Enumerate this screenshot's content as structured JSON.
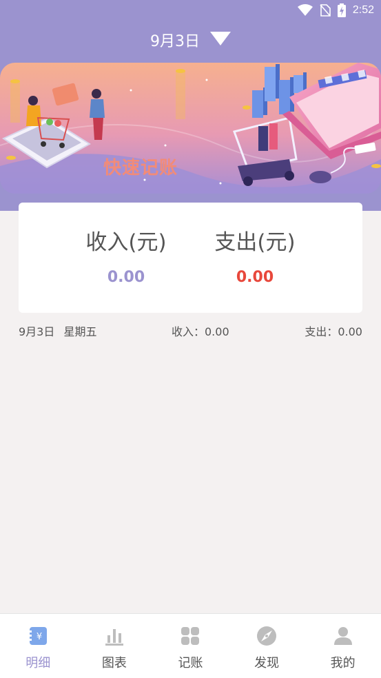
{
  "status_bar": {
    "time": "2:52",
    "icons": [
      "wifi-icon",
      "no-sim-icon",
      "battery-charging-icon"
    ]
  },
  "header": {
    "date": "9月3日",
    "dropdown_icon": "triangle-down-icon"
  },
  "banner": {
    "text": "快速记账"
  },
  "summary": {
    "income_label": "收入(元)",
    "income_value": "0.00",
    "expense_label": "支出(元)",
    "expense_value": "0.00"
  },
  "day": {
    "date": "9月3日",
    "weekday": "星期五",
    "income": "收入：0.00",
    "expense": "支出：0.00"
  },
  "tabs": [
    {
      "label": "明细",
      "icon": "ledger-icon",
      "active": true
    },
    {
      "label": "图表",
      "icon": "bar-chart-icon",
      "active": false
    },
    {
      "label": "记账",
      "icon": "grid-icon",
      "active": false
    },
    {
      "label": "发现",
      "icon": "compass-icon",
      "active": false
    },
    {
      "label": "我的",
      "icon": "user-icon",
      "active": false
    }
  ],
  "colors": {
    "accent": "#9b93cf",
    "income": "#9b93cf",
    "expense": "#e8483c",
    "inactive_icon": "#bdbdbd",
    "background": "#f4f1f1"
  }
}
